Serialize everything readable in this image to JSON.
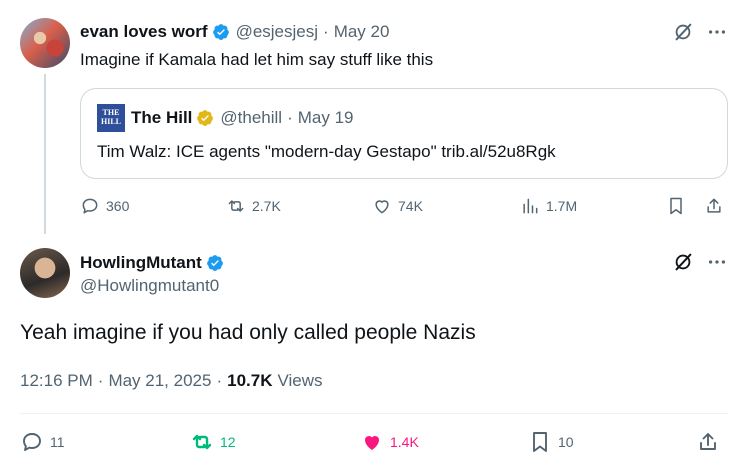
{
  "first_tweet": {
    "name": "evan loves worf",
    "handle": "@esjesjesj",
    "separator": "·",
    "date": "May 20",
    "text": "Imagine if Kamala had let him say stuff like this",
    "quote": {
      "avatar_text_top": "THE",
      "avatar_text_bottom": "HILL",
      "name": "The Hill",
      "handle": "@thehill",
      "separator": "·",
      "date": "May 19",
      "text": "Tim Walz: ICE agents \"modern-day Gestapo\" trib.al/52u8Rgk"
    },
    "actions": {
      "replies": "360",
      "reposts": "2.7K",
      "likes": "74K",
      "views": "1.7M"
    }
  },
  "second_tweet": {
    "name": "HowlingMutant",
    "handle": "@Howlingmutant0",
    "text": "Yeah imagine if you had only called people Nazis",
    "time": "12:16 PM",
    "separator": "·",
    "date": "May 21, 2025",
    "views_count": "10.7K",
    "views_label": "Views",
    "actions": {
      "replies": "11",
      "reposts": "12",
      "likes": "1.4K",
      "bookmarks": "10"
    }
  },
  "colors": {
    "verified_blue": "#1d9bf0",
    "verified_gold": "#e2b719",
    "repost_green": "#00ba7c",
    "like_pink": "#f91880",
    "muted": "#536471",
    "text": "#0f1419"
  },
  "icons": [
    "grok-icon",
    "more-icon",
    "verified-icon",
    "reply-icon",
    "repost-icon",
    "like-icon",
    "views-icon",
    "bookmark-icon",
    "share-icon"
  ]
}
